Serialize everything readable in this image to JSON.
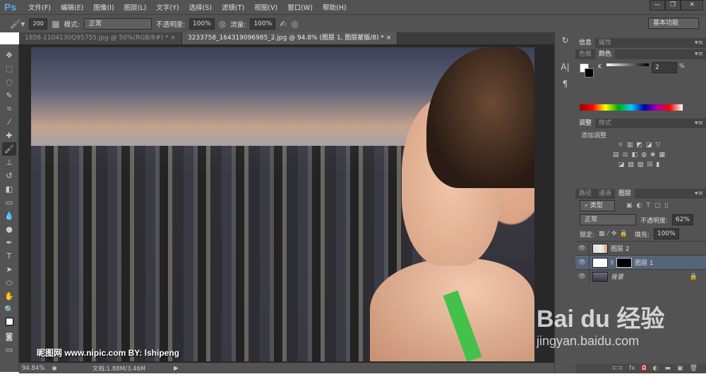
{
  "app": {
    "logo": "Ps"
  },
  "menu": [
    "文件(F)",
    "编辑(E)",
    "图像(I)",
    "图层(L)",
    "文字(Y)",
    "选择(S)",
    "滤镜(T)",
    "视图(V)",
    "窗口(W)",
    "帮助(H)"
  ],
  "window_buttons": {
    "minimize": "—",
    "restore": "❐",
    "close": "✕"
  },
  "options": {
    "brush_size": "200",
    "mode_label": "模式:",
    "mode_value": "正常",
    "opacity_label": "不透明度:",
    "opacity_value": "100%",
    "flow_label": "流量:",
    "flow_value": "100%",
    "workspace": "基本功能"
  },
  "tabs": [
    {
      "label": "1858-1104130Q95755.jpg @ 50%(RGB/8#) *",
      "close": "×"
    },
    {
      "label": "3233758_164319096985_2.jpg @ 94.8% (图层 1, 图层蒙版/8) *",
      "close": "×"
    }
  ],
  "canvas": {
    "watermark": "昵图网 www.nipic.com   BY: lshipeng"
  },
  "status": {
    "zoom": "94.84%",
    "doc": "文档:1.88M/3.46M"
  },
  "panels": {
    "info_tabs": [
      "信息",
      "属性"
    ],
    "color_tabs": [
      "色板",
      "颜色"
    ],
    "color": {
      "channel": "K",
      "value": "2",
      "unit": "%"
    },
    "adjust_tabs": [
      "调整",
      "样式"
    ],
    "adjust_title": "添加调整",
    "layer_tabs": [
      "路径",
      "通道",
      "图层"
    ],
    "filter_kind": "类型",
    "blend_mode": "正常",
    "opacity_label": "不透明度:",
    "opacity_value": "62%",
    "lock_label": "锁定:",
    "fill_label": "填充:",
    "fill_value": "100%",
    "layers": [
      {
        "name": "图层 2"
      },
      {
        "name": "图层 1"
      },
      {
        "name": "背景"
      }
    ]
  },
  "overlay": {
    "baidu_logo": "Bai du 经验",
    "baidu_url": "jingyan.baidu.com"
  }
}
